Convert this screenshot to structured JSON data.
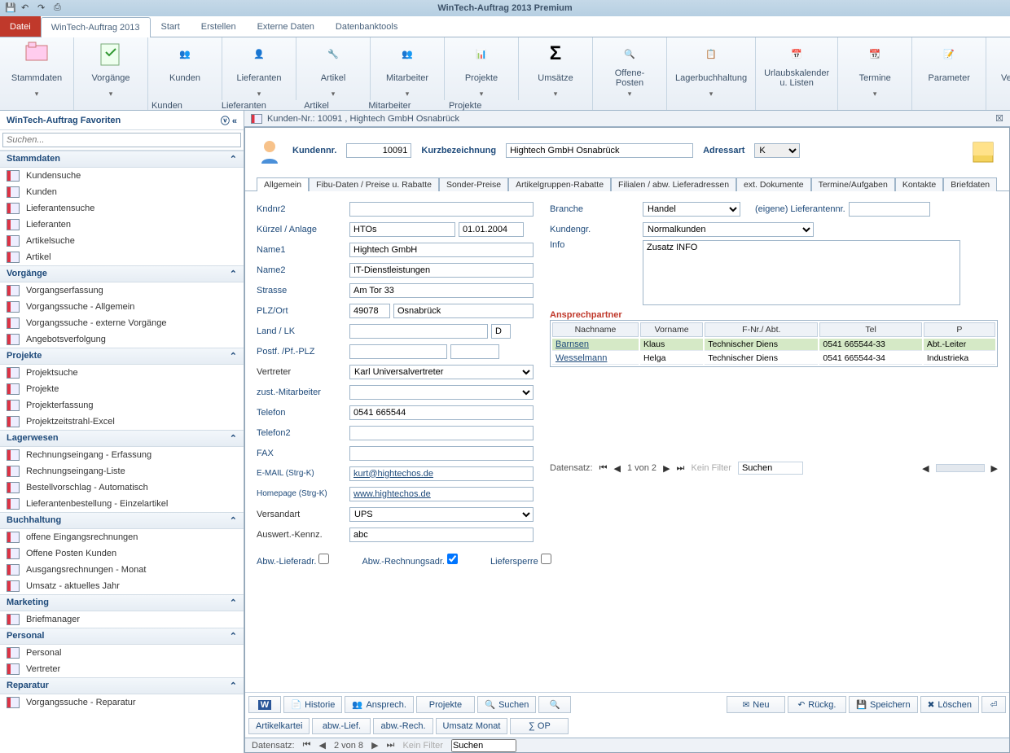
{
  "title": "WinTech-Auftrag 2013 Premium",
  "fileTab": "Datei",
  "ribbonTabs": [
    "WinTech-Auftrag 2013",
    "Start",
    "Erstellen",
    "Externe Daten",
    "Datenbanktools"
  ],
  "ribbonGroups": [
    {
      "label": "Stammdaten"
    },
    {
      "label": "Vorgänge"
    },
    {
      "label": "Kunden"
    },
    {
      "label": "Lieferanten"
    },
    {
      "label": "Artikel"
    },
    {
      "label": "Mitarbeiter"
    },
    {
      "label": "Projekte"
    },
    {
      "label": "Umsätze"
    },
    {
      "label": "Offene-Posten"
    },
    {
      "label": "Lagerbuchhaltung"
    },
    {
      "label": "Urlaubskalender u. Listen"
    },
    {
      "label": "Termine"
    },
    {
      "label": "Parameter"
    },
    {
      "label": "Verwaltung"
    },
    {
      "label": "?"
    }
  ],
  "subLinks": [
    "Kunden verwalten",
    "Lieferanten verwalten",
    "Artikel verwalten",
    "Mitarbeiter verwalten",
    "Projekte verwalten"
  ],
  "fav": {
    "title": "WinTech-Auftrag Favoriten",
    "searchPlaceholder": "Suchen...",
    "sections": [
      {
        "name": "Stammdaten",
        "items": [
          "Kundensuche",
          "Kunden",
          "Lieferantensuche",
          "Lieferanten",
          "Artikelsuche",
          "Artikel"
        ]
      },
      {
        "name": "Vorgänge",
        "items": [
          "Vorgangserfassung",
          "Vorgangssuche - Allgemein",
          "Vorgangssuche - externe Vorgänge",
          "Angebotsverfolgung"
        ]
      },
      {
        "name": "Projekte",
        "items": [
          "Projektsuche",
          "Projekte",
          "Projekterfassung",
          "Projektzeitstrahl-Excel"
        ]
      },
      {
        "name": "Lagerwesen",
        "items": [
          "Rechnungseingang - Erfassung",
          "Rechnungseingang-Liste",
          "Bestellvorschlag - Automatisch",
          "Lieferantenbestellung - Einzelartikel"
        ]
      },
      {
        "name": "Buchhaltung",
        "items": [
          "offene Eingangsrechnungen",
          "Offene Posten Kunden",
          "Ausgangsrechnungen - Monat",
          "Umsatz - aktuelles Jahr"
        ]
      },
      {
        "name": "Marketing",
        "items": [
          "Briefmanager"
        ]
      },
      {
        "name": "Personal",
        "items": [
          "Personal",
          "Vertreter"
        ]
      },
      {
        "name": "Reparatur",
        "items": [
          "Vorgangssuche - Reparatur"
        ]
      }
    ]
  },
  "doc": {
    "tabTitle": "Kunden-Nr.: 10091 , Hightech GmbH Osnabrück",
    "hdr": {
      "lblKn": "Kundennr.",
      "kn": "10091",
      "lblKb": "Kurzbezeichnung",
      "kb": "Hightech GmbH Osnabrück",
      "lblAdr": "Adressart",
      "adr": "K"
    },
    "innerTabs": [
      "Allgemein",
      "Fibu-Daten / Preise u. Rabatte",
      "Sonder-Preise",
      "Artikelgruppen-Rabatte",
      "Filialen / abw. Lieferadressen",
      "ext. Dokumente",
      "Termine/Aufgaben",
      "Kontakte",
      "Briefdaten"
    ],
    "left": {
      "kndnr2": "Kndnr2",
      "kndnr2_v": "",
      "kuerzel": "Kürzel / Anlage",
      "kuerzel_v": "HTOs",
      "anlage_v": "01.01.2004",
      "name1": "Name1",
      "name1_v": "Hightech GmbH",
      "name2": "Name2",
      "name2_v": "IT-Dienstleistungen",
      "strasse": "Strasse",
      "strasse_v": "Am Tor 33",
      "plzort": "PLZ/Ort",
      "plz_v": "49078",
      "ort_v": "Osnabrück",
      "land": "Land / LK",
      "land_v": "",
      "lk_v": "D",
      "postf": "Postf. /Pf.-PLZ",
      "postf_v": "",
      "pfplz_v": "",
      "vertreter": "Vertreter",
      "vertreter_v": "Karl Universalvertreter",
      "zust": "zust.-Mitarbeiter",
      "zust_v": "",
      "tel": "Telefon",
      "tel_v": "0541 665544",
      "tel2": "Telefon2",
      "tel2_v": "",
      "fax": "FAX",
      "fax_v": "",
      "email": "E-MAIL (Strg-K)",
      "email_v": "kurt@hightechos.de",
      "hp": "Homepage (Strg-K)",
      "hp_v": "www.hightechos.de",
      "versand": "Versandart",
      "versand_v": "UPS",
      "auswert": "Auswert.-Kennz.",
      "auswert_v": "abc"
    },
    "right": {
      "branche": "Branche",
      "branche_v": "Handel",
      "liefnr": "(eigene) Lieferantennr.",
      "liefnr_v": "",
      "kgr": "Kundengr.",
      "kgr_v": "Normalkunden",
      "info": "Info",
      "info_v": "Zusatz INFO",
      "ansprech": "Ansprechpartner",
      "cols": [
        "Nachname",
        "Vorname",
        "F-Nr./ Abt.",
        "Tel",
        "P"
      ],
      "rows": [
        {
          "nn": "Barnsen",
          "vn": "Klaus",
          "abt": "Technischer Diens",
          "tel": "0541 665544-33",
          "p": "Abt.-Leiter"
        },
        {
          "nn": "Wesselmann",
          "vn": "Helga",
          "abt": "Technischer Diens",
          "tel": "0541 665544-34",
          "p": "Industrieka"
        }
      ],
      "recnav": {
        "label": "Datensatz:",
        "pos": "1 von 2",
        "nofilter": "Kein Filter",
        "search": "Suchen"
      }
    },
    "checks": {
      "abwlief": "Abw.-Lieferadr.",
      "abwrech": "Abw.-Rechnungsadr.",
      "liefsp": "Liefersperre"
    },
    "btnbar": [
      "Historie",
      "Ansprech.",
      "Projekte",
      "Suchen"
    ],
    "btnbarR": [
      "Neu",
      "Rückg.",
      "Speichern",
      "Löschen"
    ],
    "btnbar2": [
      "Artikelkartei",
      "abw.-Lief.",
      "abw.-Rech.",
      "Umsatz Monat",
      "∑  OP"
    ],
    "status": {
      "label": "Datensatz:",
      "pos": "2 von 8",
      "nofilter": "Kein Filter",
      "search": "Suchen"
    }
  }
}
